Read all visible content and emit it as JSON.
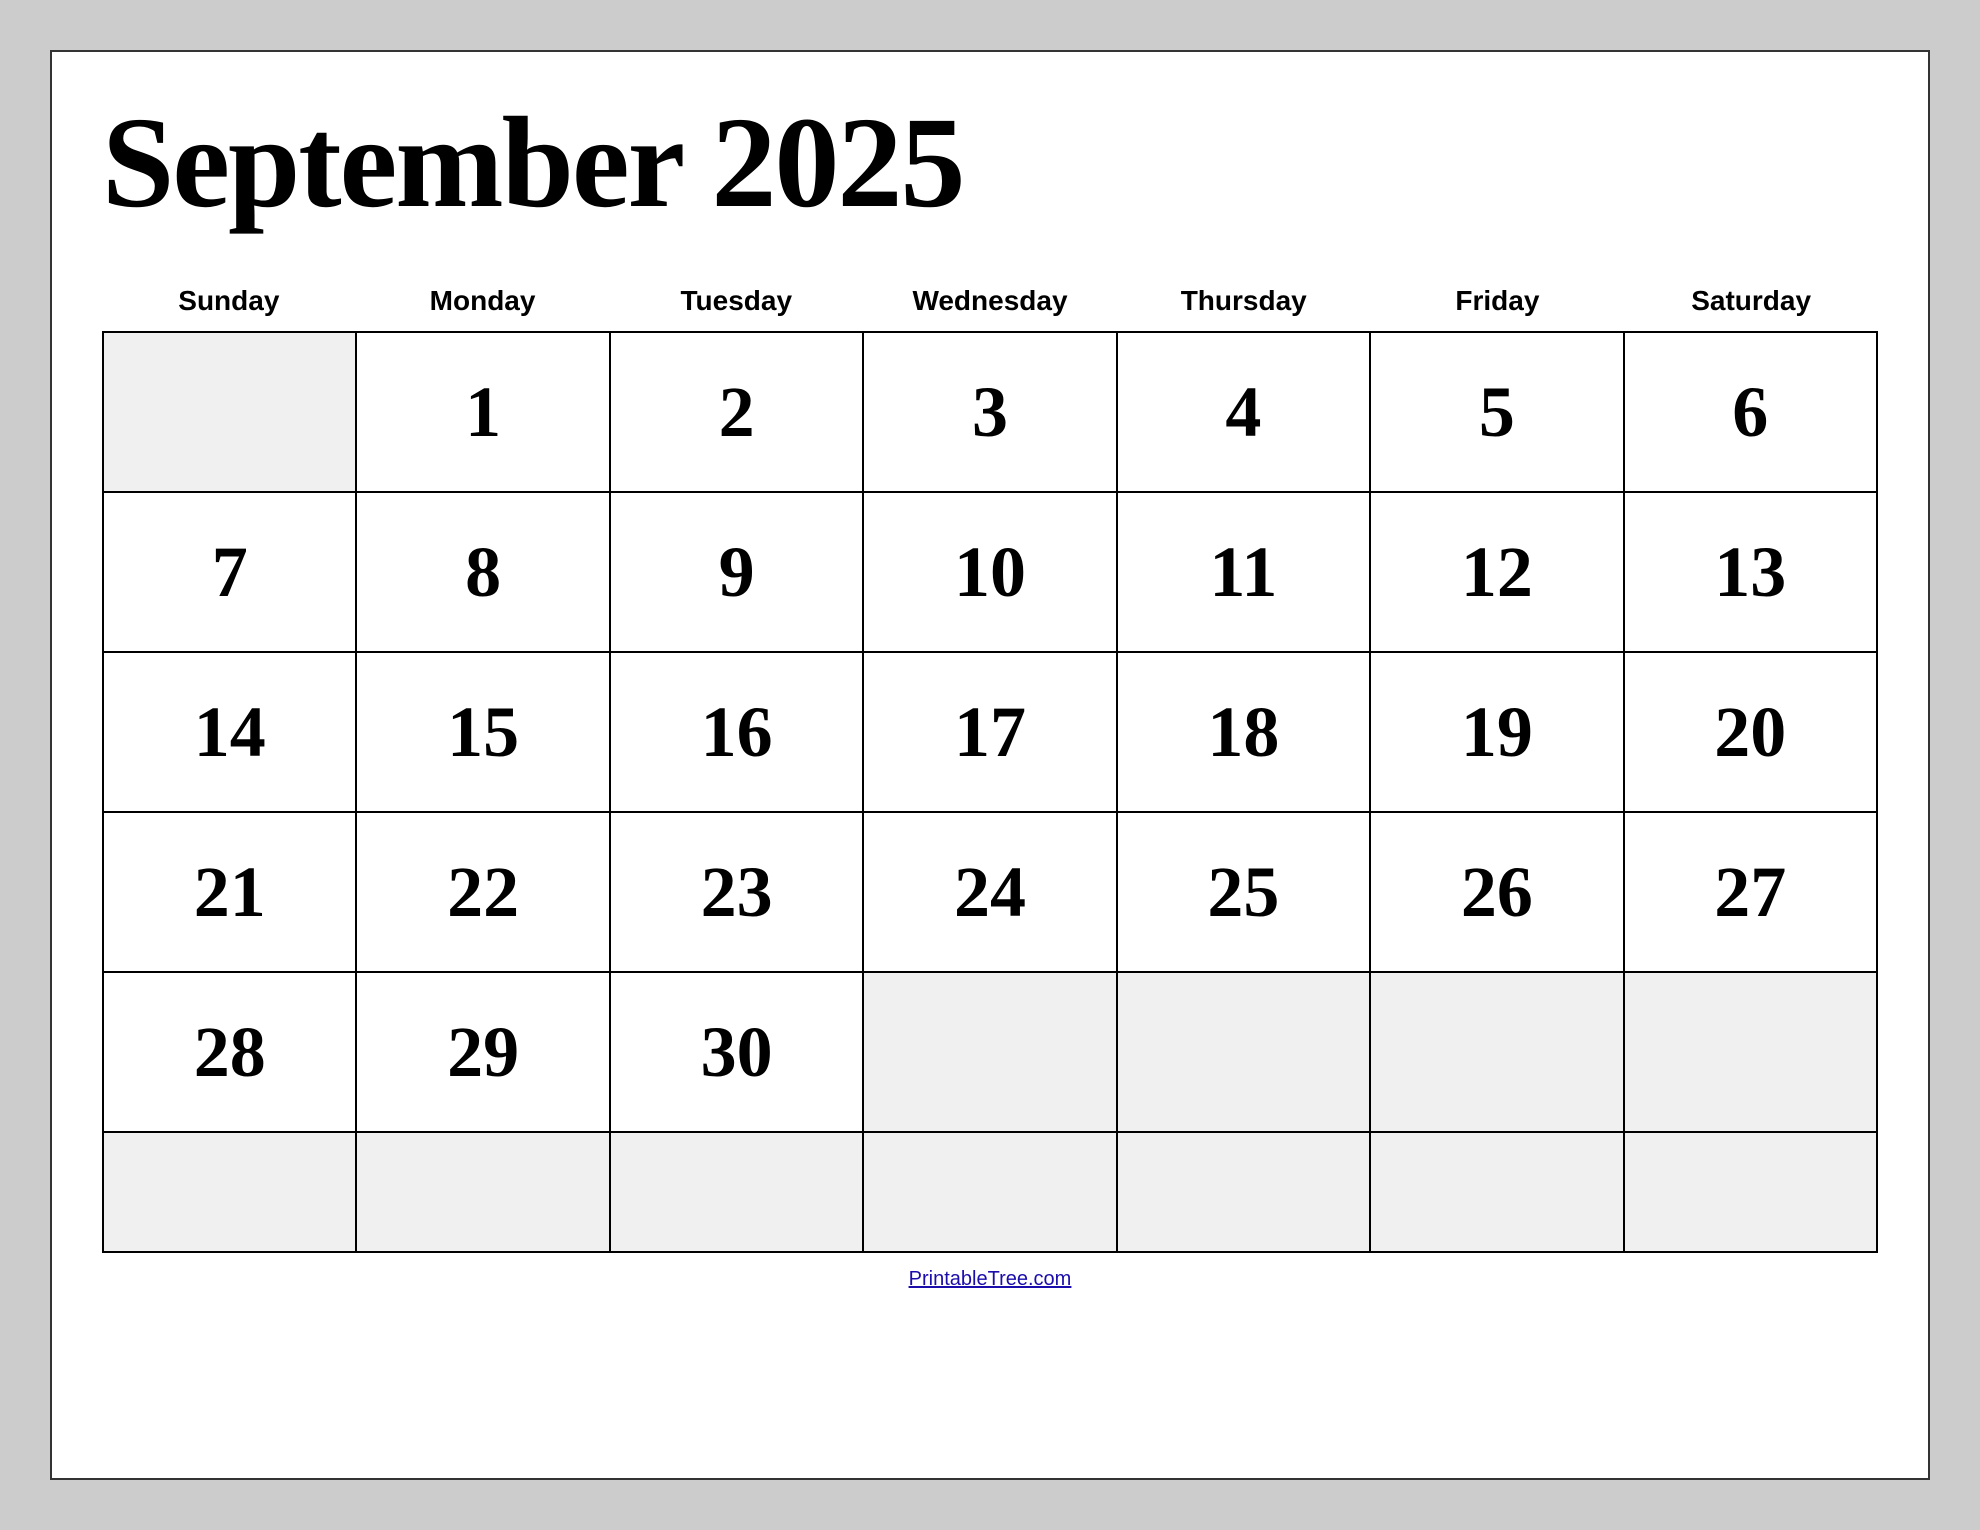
{
  "title": "September 2025",
  "headers": [
    "Sunday",
    "Monday",
    "Tuesday",
    "Wednesday",
    "Thursday",
    "Friday",
    "Saturday"
  ],
  "weeks": [
    [
      {
        "day": "",
        "empty": true
      },
      {
        "day": "1",
        "empty": false
      },
      {
        "day": "2",
        "empty": false
      },
      {
        "day": "3",
        "empty": false
      },
      {
        "day": "4",
        "empty": false
      },
      {
        "day": "5",
        "empty": false
      },
      {
        "day": "6",
        "empty": false
      }
    ],
    [
      {
        "day": "7",
        "empty": false
      },
      {
        "day": "8",
        "empty": false
      },
      {
        "day": "9",
        "empty": false
      },
      {
        "day": "10",
        "empty": false
      },
      {
        "day": "11",
        "empty": false
      },
      {
        "day": "12",
        "empty": false
      },
      {
        "day": "13",
        "empty": false
      }
    ],
    [
      {
        "day": "14",
        "empty": false
      },
      {
        "day": "15",
        "empty": false
      },
      {
        "day": "16",
        "empty": false
      },
      {
        "day": "17",
        "empty": false
      },
      {
        "day": "18",
        "empty": false
      },
      {
        "day": "19",
        "empty": false
      },
      {
        "day": "20",
        "empty": false
      }
    ],
    [
      {
        "day": "21",
        "empty": false
      },
      {
        "day": "22",
        "empty": false
      },
      {
        "day": "23",
        "empty": false
      },
      {
        "day": "24",
        "empty": false
      },
      {
        "day": "25",
        "empty": false
      },
      {
        "day": "26",
        "empty": false
      },
      {
        "day": "27",
        "empty": false
      }
    ],
    [
      {
        "day": "28",
        "empty": false
      },
      {
        "day": "29",
        "empty": false
      },
      {
        "day": "30",
        "empty": false
      },
      {
        "day": "",
        "empty": true
      },
      {
        "day": "",
        "empty": true
      },
      {
        "day": "",
        "empty": true
      },
      {
        "day": "",
        "empty": true
      }
    ],
    [
      {
        "day": "",
        "empty": true
      },
      {
        "day": "",
        "empty": true
      },
      {
        "day": "",
        "empty": true
      },
      {
        "day": "",
        "empty": true
      },
      {
        "day": "",
        "empty": true
      },
      {
        "day": "",
        "empty": true
      },
      {
        "day": "",
        "empty": true
      }
    ]
  ],
  "footer": {
    "link_text": "PrintableTree.com",
    "link_url": "https://PrintableTree.com"
  }
}
